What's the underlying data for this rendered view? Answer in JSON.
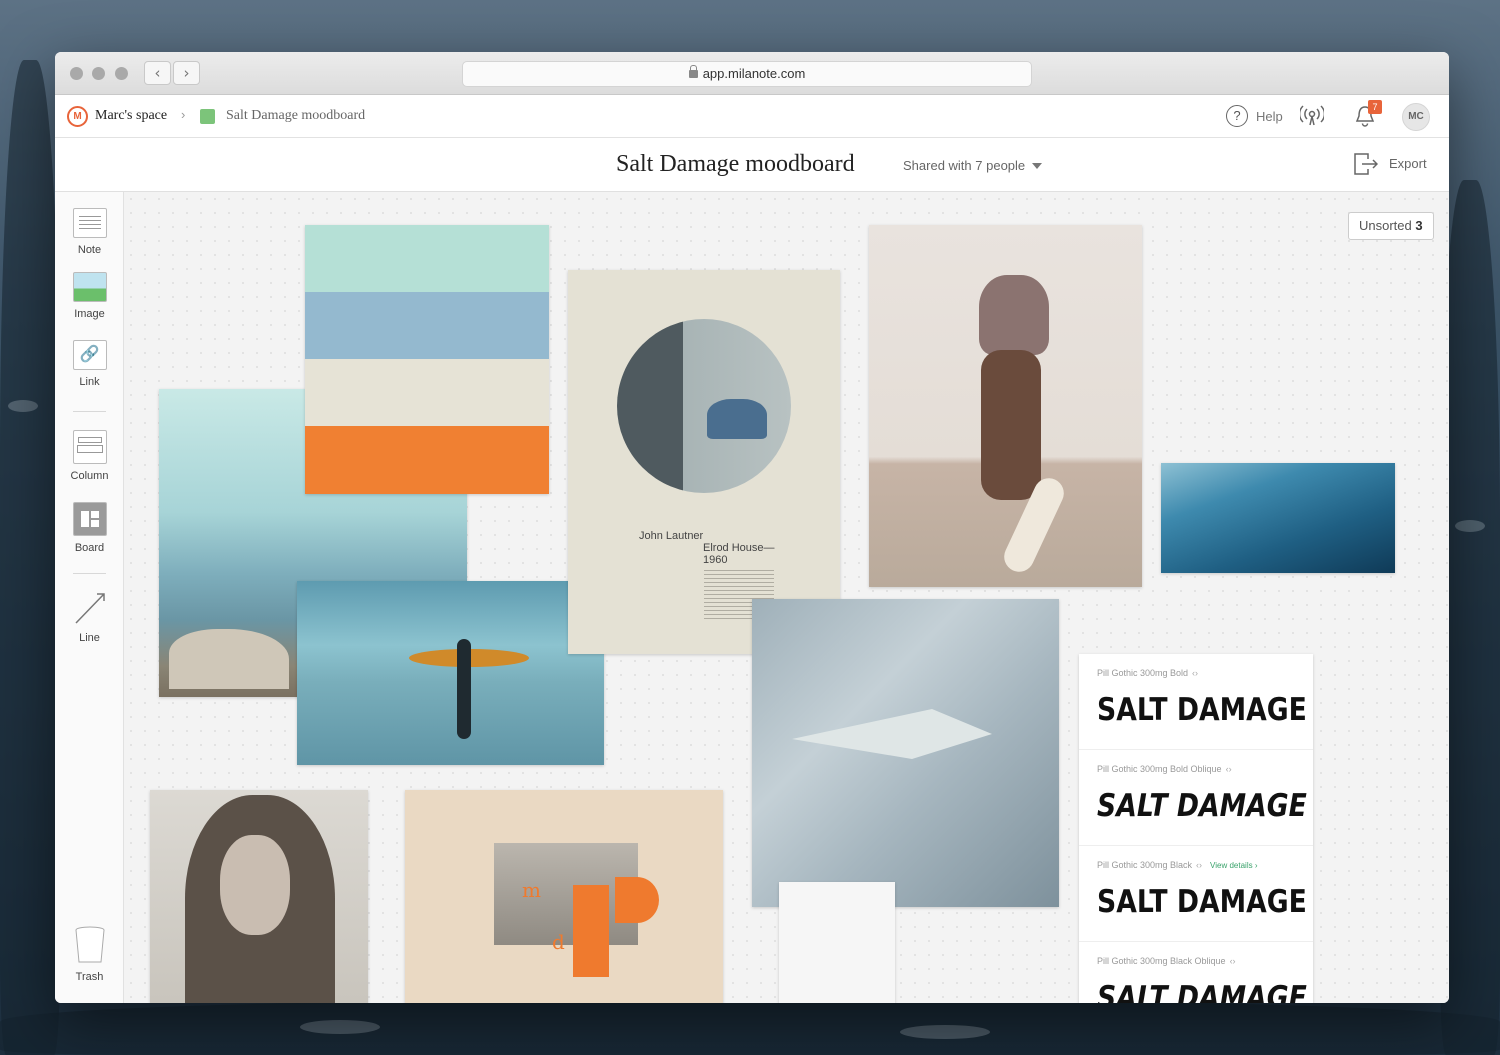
{
  "browser": {
    "url": "app.milanote.com"
  },
  "breadcrumb": {
    "space": "Marc's space",
    "board": "Salt Damage moodboard"
  },
  "header": {
    "help_label": "Help",
    "notification_count": "7",
    "avatar_initials": "MC"
  },
  "board": {
    "title": "Salt Damage moodboard",
    "shared": "Shared with 7 people",
    "export_label": "Export",
    "unsorted_label": "Unsorted",
    "unsorted_count": "3"
  },
  "tools": {
    "note": "Note",
    "image": "Image",
    "link": "Link",
    "column": "Column",
    "board": "Board",
    "line": "Line",
    "trash": "Trash"
  },
  "palette": {
    "colors": [
      "#b5e0d6",
      "#94b9cf",
      "#e6e3d6",
      "#f08032"
    ]
  },
  "poster": {
    "author": "John Lautner",
    "work": "Elrod House—",
    "year": "1960"
  },
  "fonts": [
    {
      "name": "Pill Gothic 300mg Bold",
      "sample": "SALT DAMAGE",
      "italic": false,
      "details": ""
    },
    {
      "name": "Pill Gothic 300mg Bold Oblique",
      "sample": "SALT DAMAGE",
      "italic": true,
      "details": ""
    },
    {
      "name": "Pill Gothic 300mg Black",
      "sample": "SALT DAMAGE",
      "italic": false,
      "details": "View details ›"
    },
    {
      "name": "Pill Gothic 300mg Black Oblique",
      "sample": "SALT DAMAGE",
      "italic": true,
      "details": ""
    }
  ],
  "collage_letters": {
    "m": "m",
    "d": "d"
  }
}
